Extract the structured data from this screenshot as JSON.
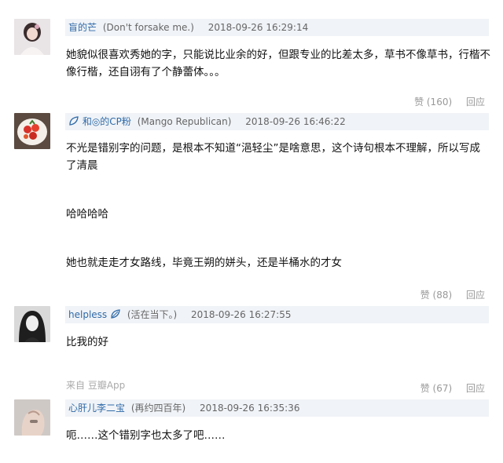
{
  "comments": [
    {
      "username": "盲的芒",
      "note": "(Don't forsake me.)",
      "time": "2018-09-26 16:29:14",
      "paragraphs": [
        "她貌似很喜欢秀她的字，只能说比业余的好，但跟专业的比差太多，草书不像草书，行楷不像行楷，还自诩有了个静蕾体。。。"
      ],
      "like": "赞 (160)",
      "reply": "回应"
    },
    {
      "username": "和◎的CP粉",
      "note": "(Mango Republican)",
      "time": "2018-09-26 16:46:22",
      "paragraphs": [
        "不光是错别字的问题，是根本不知道“浥轻尘”是啥意思，这个诗句根本不理解，所以写成了清晨",
        "哈哈哈哈",
        "她也就走走才女路线，毕竟王朔的姘头，还是半桶水的才女"
      ],
      "like": "赞 (88)",
      "reply": "回应"
    },
    {
      "username": "helpless",
      "note": "(活在当下。)",
      "time": "2018-09-26 16:27:55",
      "paragraphs": [
        "比我的好"
      ],
      "source": "来自 豆瓣App",
      "like": "赞 (67)",
      "reply": "回应"
    },
    {
      "username": "心肝儿李二宝",
      "note": "(再约四百年)",
      "time": "2018-09-26 16:35:36",
      "paragraphs": [
        "呃……这个错别字也太多了吧……"
      ]
    }
  ],
  "colors": {
    "username": "#2f6aa8",
    "header_bg": "#f0f3f7",
    "muted": "#999999"
  },
  "icons": [
    "avatar-girl-photo",
    "avatar-tomato-dish-photo",
    "avatar-girl-bw-photo",
    "avatar-hand-photo",
    "leaf-icon"
  ]
}
